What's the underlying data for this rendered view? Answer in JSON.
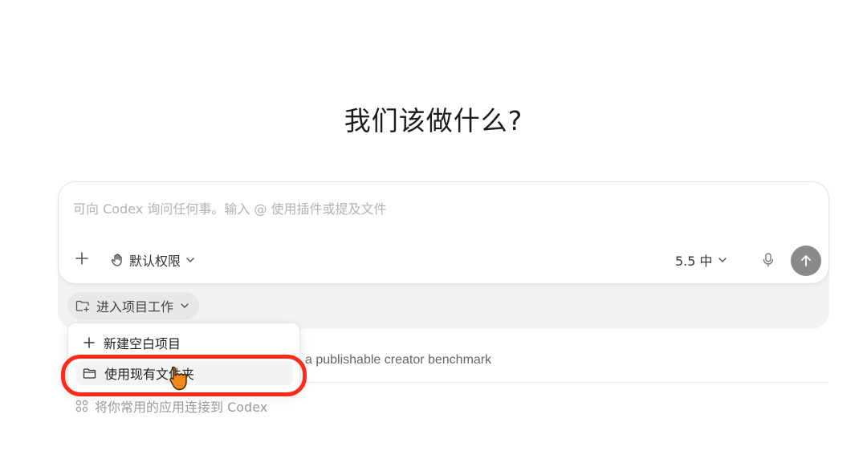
{
  "heading": "我们该做什么?",
  "composer": {
    "placeholder": "可向 Codex 询问任何事。输入 @ 使用插件或提及文件",
    "permission_label": "默认权限",
    "model_label": "5.5 中"
  },
  "project_chip": {
    "label": "进入项目工作"
  },
  "dropdown": {
    "items": [
      {
        "label": "新建空白项目",
        "icon": "plus-icon"
      },
      {
        "label": "使用现有文件夹",
        "icon": "folder-icon"
      }
    ]
  },
  "suggestion_text": "a publishable creator benchmark",
  "connect_apps_label": "将你常用的应用连接到 Codex",
  "colors": {
    "highlight": "#ff2a1a",
    "send_button": "#8a8a8a",
    "cursor": "#f08a1c"
  }
}
